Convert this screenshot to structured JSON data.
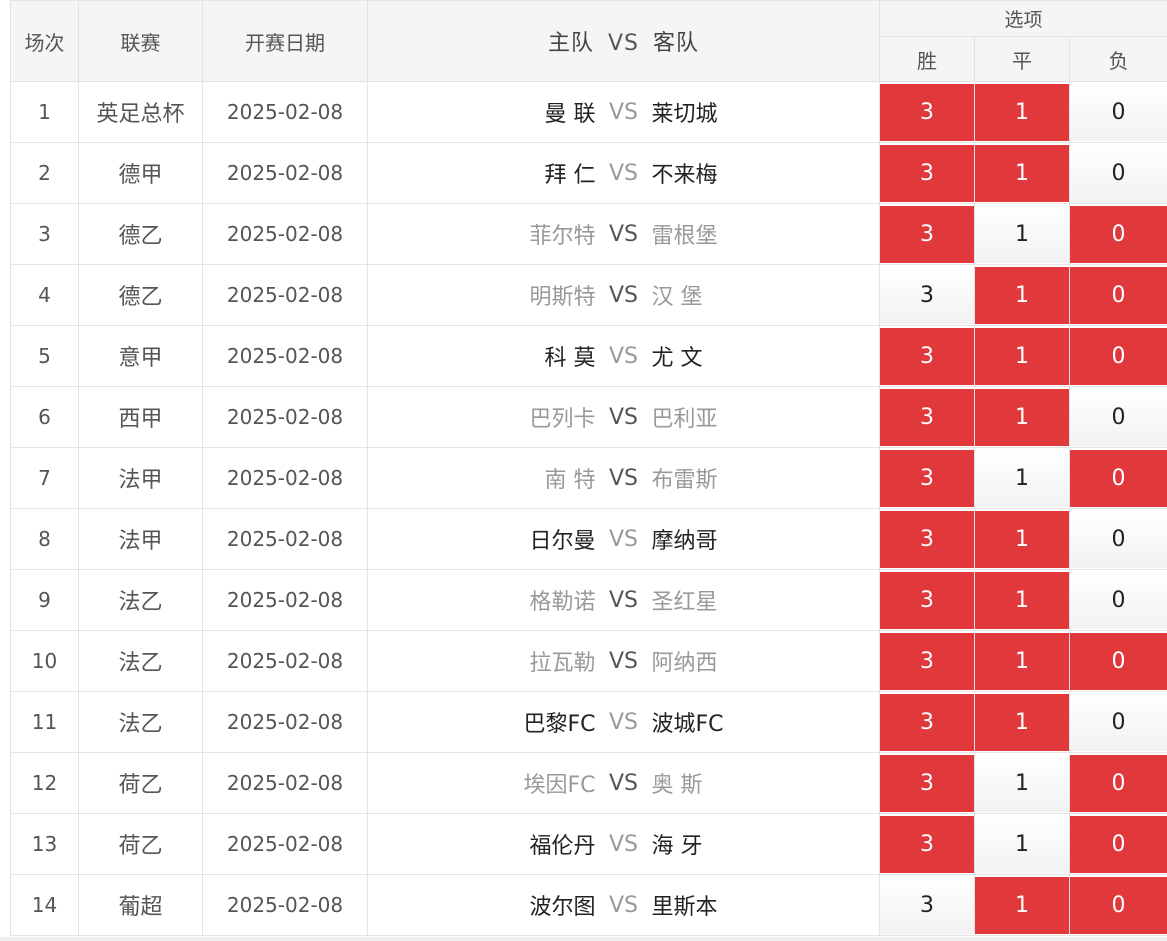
{
  "header": {
    "col_no": "场次",
    "col_league": "联赛",
    "col_date": "开赛日期",
    "col_home": "主队",
    "col_vs": "VS",
    "col_away": "客队",
    "col_options": "选项",
    "opt_win": "胜",
    "opt_draw": "平",
    "opt_lose": "负"
  },
  "colors": {
    "selected": "#e0383b",
    "dim_team": "#999999",
    "dark_team": "#222222"
  },
  "rows": [
    {
      "no": "1",
      "league": "英足总杯",
      "date": "2025-02-08",
      "home": "曼 联",
      "vs": "VS",
      "away": "莱切城",
      "dim": false,
      "win": "3",
      "draw": "1",
      "lose": "0",
      "win_sel": true,
      "draw_sel": true,
      "lose_sel": false
    },
    {
      "no": "2",
      "league": "德甲",
      "date": "2025-02-08",
      "home": "拜 仁",
      "vs": "VS",
      "away": "不来梅",
      "dim": false,
      "win": "3",
      "draw": "1",
      "lose": "0",
      "win_sel": true,
      "draw_sel": true,
      "lose_sel": false
    },
    {
      "no": "3",
      "league": "德乙",
      "date": "2025-02-08",
      "home": "菲尔特",
      "vs": "VS",
      "away": "雷根堡",
      "dim": true,
      "win": "3",
      "draw": "1",
      "lose": "0",
      "win_sel": true,
      "draw_sel": false,
      "lose_sel": true
    },
    {
      "no": "4",
      "league": "德乙",
      "date": "2025-02-08",
      "home": "明斯特",
      "vs": "VS",
      "away": "汉 堡",
      "dim": true,
      "win": "3",
      "draw": "1",
      "lose": "0",
      "win_sel": false,
      "draw_sel": true,
      "lose_sel": true
    },
    {
      "no": "5",
      "league": "意甲",
      "date": "2025-02-08",
      "home": "科 莫",
      "vs": "VS",
      "away": "尤 文",
      "dim": false,
      "win": "3",
      "draw": "1",
      "lose": "0",
      "win_sel": true,
      "draw_sel": true,
      "lose_sel": true
    },
    {
      "no": "6",
      "league": "西甲",
      "date": "2025-02-08",
      "home": "巴列卡",
      "vs": "VS",
      "away": "巴利亚",
      "dim": true,
      "win": "3",
      "draw": "1",
      "lose": "0",
      "win_sel": true,
      "draw_sel": true,
      "lose_sel": false
    },
    {
      "no": "7",
      "league": "法甲",
      "date": "2025-02-08",
      "home": "南 特",
      "vs": "VS",
      "away": "布雷斯",
      "dim": true,
      "win": "3",
      "draw": "1",
      "lose": "0",
      "win_sel": true,
      "draw_sel": false,
      "lose_sel": true
    },
    {
      "no": "8",
      "league": "法甲",
      "date": "2025-02-08",
      "home": "日尔曼",
      "vs": "VS",
      "away": "摩纳哥",
      "dim": false,
      "win": "3",
      "draw": "1",
      "lose": "0",
      "win_sel": true,
      "draw_sel": true,
      "lose_sel": false
    },
    {
      "no": "9",
      "league": "法乙",
      "date": "2025-02-08",
      "home": "格勒诺",
      "vs": "VS",
      "away": "圣红星",
      "dim": true,
      "win": "3",
      "draw": "1",
      "lose": "0",
      "win_sel": true,
      "draw_sel": true,
      "lose_sel": false
    },
    {
      "no": "10",
      "league": "法乙",
      "date": "2025-02-08",
      "home": "拉瓦勒",
      "vs": "VS",
      "away": "阿纳西",
      "dim": true,
      "win": "3",
      "draw": "1",
      "lose": "0",
      "win_sel": true,
      "draw_sel": true,
      "lose_sel": true
    },
    {
      "no": "11",
      "league": "法乙",
      "date": "2025-02-08",
      "home": "巴黎FC",
      "vs": "VS",
      "away": "波城FC",
      "dim": false,
      "win": "3",
      "draw": "1",
      "lose": "0",
      "win_sel": true,
      "draw_sel": true,
      "lose_sel": false
    },
    {
      "no": "12",
      "league": "荷乙",
      "date": "2025-02-08",
      "home": "埃因FC",
      "vs": "VS",
      "away": "奥 斯",
      "dim": true,
      "win": "3",
      "draw": "1",
      "lose": "0",
      "win_sel": true,
      "draw_sel": false,
      "lose_sel": true
    },
    {
      "no": "13",
      "league": "荷乙",
      "date": "2025-02-08",
      "home": "福伦丹",
      "vs": "VS",
      "away": "海 牙",
      "dim": false,
      "win": "3",
      "draw": "1",
      "lose": "0",
      "win_sel": true,
      "draw_sel": false,
      "lose_sel": true
    },
    {
      "no": "14",
      "league": "葡超",
      "date": "2025-02-08",
      "home": "波尔图",
      "vs": "VS",
      "away": "里斯本",
      "dim": false,
      "win": "3",
      "draw": "1",
      "lose": "0",
      "win_sel": false,
      "draw_sel": true,
      "lose_sel": true
    }
  ]
}
